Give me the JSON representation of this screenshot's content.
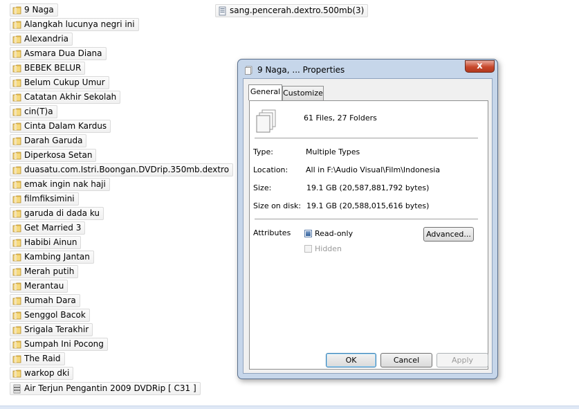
{
  "desktop": {
    "folders": [
      "9 Naga",
      "Alangkah lucunya negri ini",
      "Alexandria",
      "Asmara Dua Diana",
      "BEBEK BELUR",
      "Belum Cukup Umur",
      "Catatan Akhir Sekolah",
      "cin(T)a",
      "Cinta Dalam Kardus",
      "Darah Garuda",
      "Diperkosa Setan",
      "duasatu.com.Istri.Boongan.DVDrip.350mb.dextro",
      "emak ingin nak haji",
      "filmfiksimini",
      "garuda di dada ku",
      "Get Married 3",
      "Habibi Ainun",
      "Kambing Jantan",
      "Merah putih",
      "Merantau",
      "Rumah Dara",
      "Senggol Bacok",
      "Srigala Terakhir",
      "Sumpah Ini Pocong",
      "The Raid",
      "warkop dki"
    ],
    "archive_file": "Air Terjun Pengantin 2009 DVDRip [ C31 ]",
    "top_file": "sang.pencerah.dextro.500mb(3)"
  },
  "dialog": {
    "title": "9 Naga, ... Properties",
    "close_label": "x",
    "tabs": [
      "General",
      "Customize"
    ],
    "active_tab": "General",
    "summary": "61 Files, 27 Folders",
    "properties": [
      {
        "label": "Type:",
        "value": "Multiple Types"
      },
      {
        "label": "Location:",
        "value": "All in F:\\Audio Visual\\Film\\Indonesia"
      },
      {
        "label": "Size:",
        "value": "19.1 GB (20,587,881,792 bytes)"
      },
      {
        "label": "Size on disk:",
        "value": "19.1 GB (20,588,015,616 bytes)"
      }
    ],
    "attributes_label": "Attributes",
    "readonly_label": "Read-only",
    "readonly_checked": true,
    "hidden_label": "Hidden",
    "hidden_checked": false,
    "advanced_button": "Advanced...",
    "buttons": {
      "ok": "OK",
      "cancel": "Cancel",
      "apply": "Apply"
    }
  },
  "icons": {
    "folder": "folder-icon",
    "file": "file-icon",
    "archive": "archive-file-icon",
    "multiple_files": "multiple-files-icon"
  }
}
